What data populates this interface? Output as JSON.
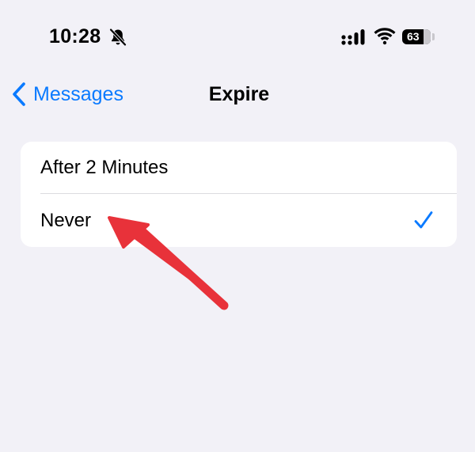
{
  "status_bar": {
    "time": "10:28",
    "battery_level": "63",
    "icons": [
      "bell-slash-icon",
      "signal-icon",
      "wifi-icon",
      "battery-icon"
    ]
  },
  "nav": {
    "back_label": "Messages",
    "title": "Expire"
  },
  "options": [
    {
      "label": "After 2 Minutes",
      "selected": false
    },
    {
      "label": "Never",
      "selected": true
    }
  ],
  "colors": {
    "accent": "#0a7aff",
    "background": "#f2f1f7",
    "card": "#ffffff",
    "annotation": "#e8323a"
  }
}
